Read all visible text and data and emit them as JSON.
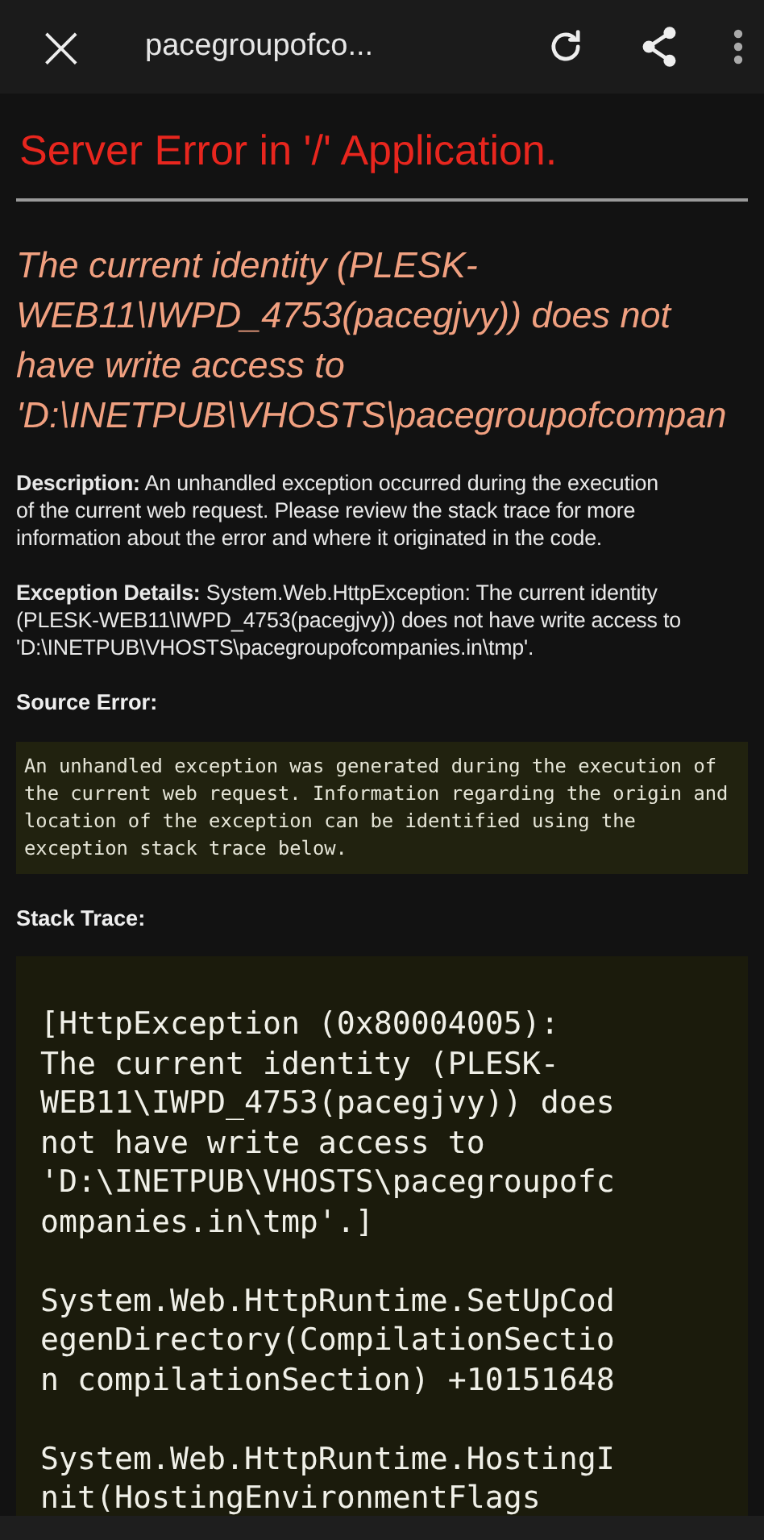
{
  "browser_bar": {
    "close": "×",
    "url": "pacegroupofco..."
  },
  "title": "Server Error in '/' Application.",
  "heading_lines": [
    "The current identity (PLESK-",
    "WEB11\\IWPD_4753(pacegjvy)) does not",
    "have write access to",
    "'D:\\INETPUB\\VHOSTS\\pacegroupofcompan"
  ],
  "description_lines": [
    "**Description:** An unhandled exception occurred during the execution",
    "of the current web request. Please review the stack trace for more",
    "information about the error and where it originated in the code."
  ],
  "exception_lines": [
    "**Exception Details:** System.Web.HttpException: The current identity",
    "(PLESK-WEB11\\IWPD_4753(pacegjvy)) does not have write access to",
    "'D:\\INETPUB\\VHOSTS\\pacegroupofcompanies.in\\tmp'."
  ],
  "source_error_label": "Source Error:",
  "source_error_lines": [
    "An unhandled exception was generated during the execution of",
    "the current web request. Information regarding the origin and",
    "location of the exception can be identified using the",
    "exception stack trace below."
  ],
  "stack_trace_label": "Stack Trace:",
  "stack_trace_blocks": [
    [
      "[HttpException (0x80004005):",
      "The current identity (PLESK-",
      "WEB11\\IWPD_4753(pacegjvy)) does",
      "not have write access to",
      "'D:\\INETPUB\\VHOSTS\\pacegroupofc",
      "ompanies.in\\tmp'.]"
    ],
    [
      "System.Web.HttpRuntime.SetUpCod",
      "egenDirectory(CompilationSectio",
      "n compilationSection) +10151648"
    ],
    [
      "System.Web.HttpRuntime.HostingI",
      "nit(HostingEnvironmentFlags"
    ]
  ]
}
